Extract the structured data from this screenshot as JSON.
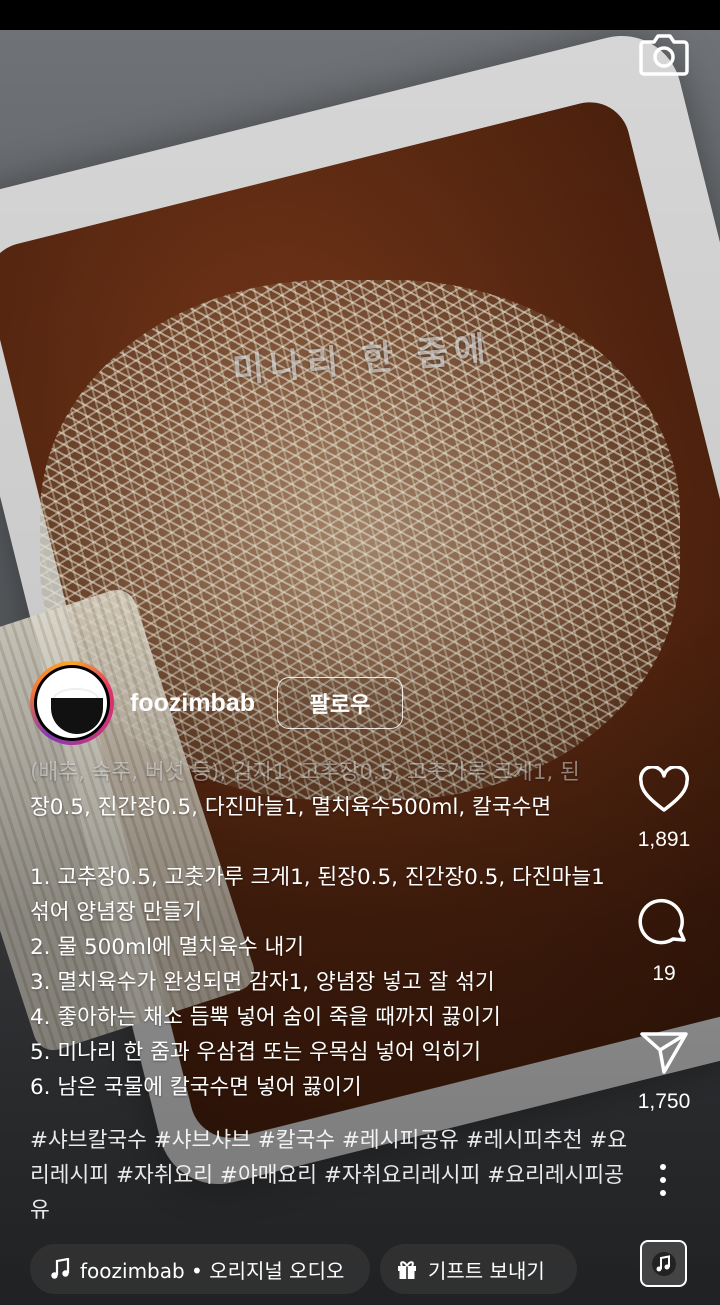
{
  "video": {
    "overlay_text": "미나리 한 줌에"
  },
  "author": {
    "username": "foozimbab",
    "follow_label": "팔로우"
  },
  "caption": {
    "ingredients_line1": "(배추, 숙주, 버섯 등), 감자1, 고추장0.5, 고춧가루 크게1, 된",
    "ingredients_line2": "장0.5, 진간장0.5, 다진마늘1, 멸치육수500ml, 칼국수면",
    "steps": [
      "1. 고추장0.5, 고춧가루 크게1, 된장0.5, 진간장0.5, 다진마늘1 섞어 양념장 만들기",
      "2. 물 500ml에 멸치육수 내기",
      "3. 멸치육수가 완성되면 감자1, 양념장 넣고 잘 섞기",
      "4. 좋아하는 채소 듬뿍 넣어 숨이 죽을 때까지 끓이기",
      "5. 미나리 한 줌과 우삼겹 또는 우목심 넣어 익히기",
      "6. 남은 국물에 칼국수면 넣어 끓이기"
    ],
    "hashtags": "#샤브칼국수 #샤브샤브 #칼국수 #레시피공유 #레시피추천 #요리레시피 #자취요리 #야매요리 #자취요리레시피 #요리레시피공유"
  },
  "actions": {
    "likes": "1,891",
    "comments": "19",
    "shares": "1,750"
  },
  "audio": {
    "label": "foozimbab • 오리지널 오디오"
  },
  "gift": {
    "label": "기프트 보내기"
  },
  "icons": {
    "camera": "camera-icon",
    "like": "heart-icon",
    "comment": "comment-icon",
    "share": "send-icon",
    "more": "more-icon",
    "music": "music-note-icon",
    "gift": "gift-icon"
  }
}
